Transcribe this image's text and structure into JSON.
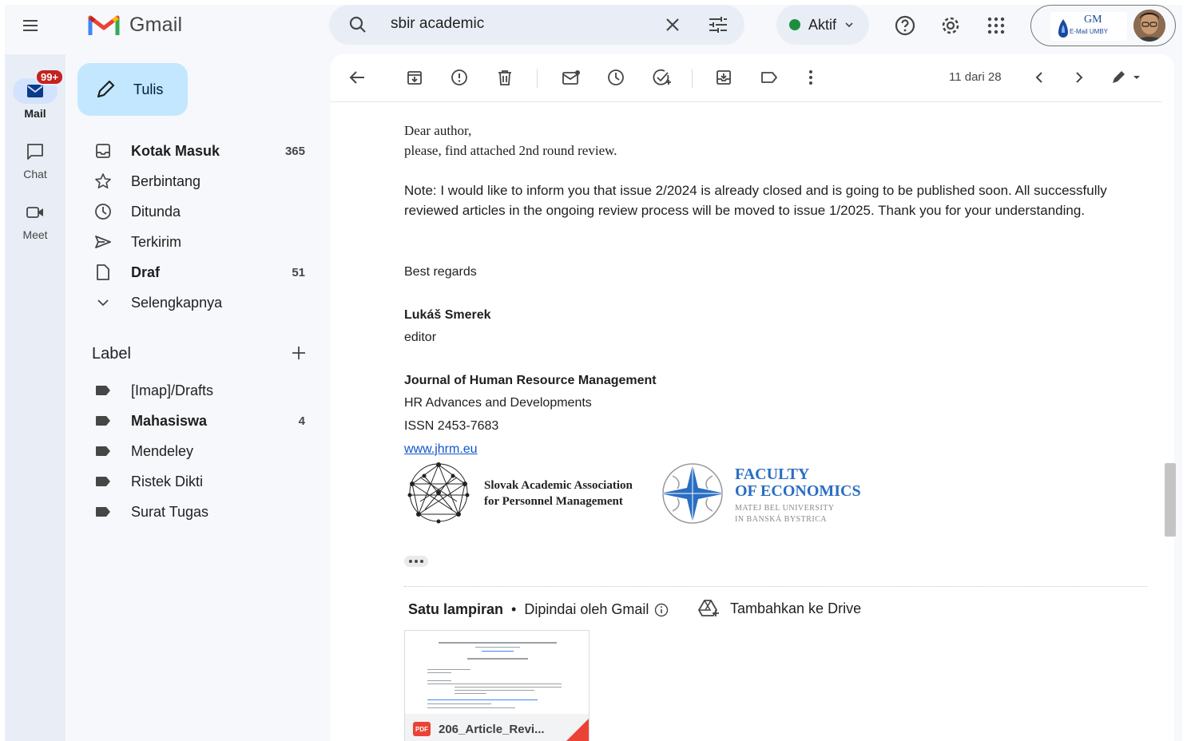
{
  "app": {
    "name": "Gmail"
  },
  "search": {
    "query": "sbir academic"
  },
  "status": {
    "label": "Aktif"
  },
  "account": {
    "org_logo": "GM",
    "org_sub": "E-Mail UMBY"
  },
  "rail": {
    "mail": {
      "label": "Mail",
      "badge": "99+"
    },
    "chat": {
      "label": "Chat"
    },
    "meet": {
      "label": "Meet"
    }
  },
  "compose": {
    "label": "Tulis"
  },
  "nav": [
    {
      "label": "Kotak Masuk",
      "count": "365",
      "icon": "inbox-icon"
    },
    {
      "label": "Berbintang",
      "count": "",
      "icon": "star-icon"
    },
    {
      "label": "Ditunda",
      "count": "",
      "icon": "clock-icon"
    },
    {
      "label": "Terkirim",
      "count": "",
      "icon": "send-icon"
    },
    {
      "label": "Draf",
      "count": "51",
      "icon": "draft-icon"
    },
    {
      "label": "Selengkapnya",
      "count": "",
      "icon": "chevron-down-icon"
    }
  ],
  "labels": {
    "heading": "Label",
    "items": [
      {
        "label": "[Imap]/Drafts",
        "count": ""
      },
      {
        "label": "Mahasiswa",
        "count": "4"
      },
      {
        "label": "Mendeley",
        "count": ""
      },
      {
        "label": "Ristek Dikti",
        "count": ""
      },
      {
        "label": "Surat Tugas",
        "count": ""
      }
    ]
  },
  "toolbar": {
    "pager": "11 dari 28"
  },
  "email": {
    "greeting": "Dear author,",
    "intro": "please, find attached 2nd round review.",
    "note": "Note: I would like to inform you that issue 2/2024 is already closed and is going to be published soon. All successfully reviewed articles in the ongoing review process will be moved to issue 1/2025. Thank you for your understanding.",
    "closing": "Best regards",
    "sender_name": "Lukáš Smerek",
    "sender_role": "editor",
    "journal": "Journal of Human Resource Management",
    "journal_sub": "HR Advances and Developments",
    "issn": "ISSN 2453-7683",
    "website": "www.jhrm.eu",
    "logo1_line1": "Slovak Academic Association",
    "logo1_line2": "for Personnel Management",
    "logo2_line1": "FACULTY",
    "logo2_line2": "OF ECONOMICS",
    "logo2_sub1": "MATEJ BEL UNIVERSITY",
    "logo2_sub2": "IN BANSKÁ BYSTRICA"
  },
  "attachments": {
    "heading": "Satu lampiran",
    "scanned": "Dipindai oleh Gmail",
    "add_drive": "Tambahkan ke Drive",
    "file_type": "PDF",
    "file_name": "206_Article_Revi..."
  }
}
